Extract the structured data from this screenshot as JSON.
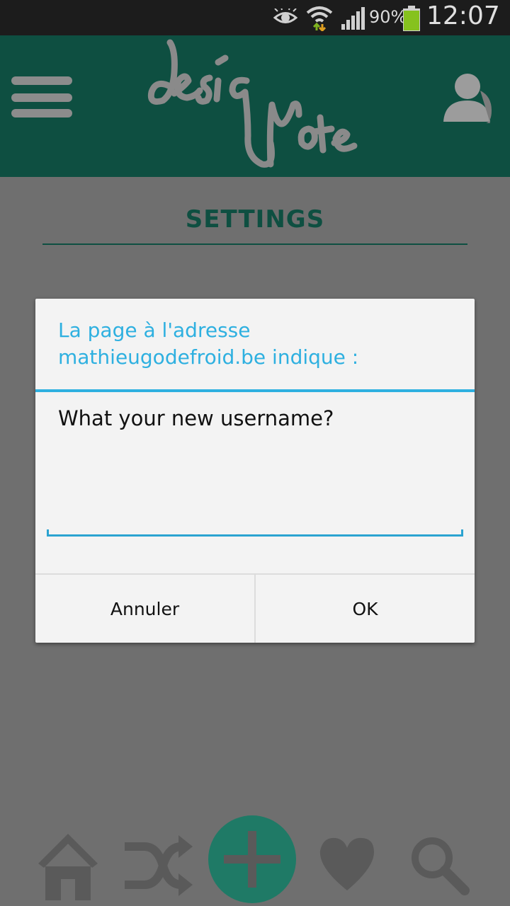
{
  "status_bar": {
    "battery_percent": "90%",
    "time": "12:07",
    "icons": [
      "eye-icon",
      "wifi-icon",
      "signal-icon",
      "battery-icon"
    ]
  },
  "header": {
    "logo_alt": "designote",
    "menu_icon": "hamburger-menu-icon",
    "profile_icon": "user-avatar-icon",
    "background": "#0e4f41"
  },
  "page": {
    "title": "SETTINGS"
  },
  "dialog": {
    "title_line1": "La page à l'adresse",
    "title_line2": "mathieugodefroid.be indique :",
    "message": "What your new username?",
    "input_value": "",
    "cancel_label": "Annuler",
    "ok_label": "OK",
    "accent": "#2eb0e0"
  },
  "bottom_nav": {
    "items": [
      "home-icon",
      "shuffle-icon",
      "add-icon",
      "heart-icon",
      "search-icon"
    ],
    "accent": "#1f7a66"
  }
}
